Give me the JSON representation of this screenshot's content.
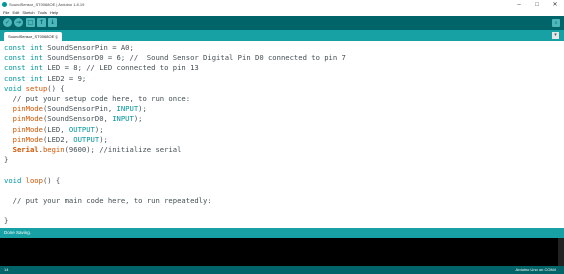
{
  "window": {
    "title": "SoundSensor_ST0068OE | Arduino 1.8.19",
    "minimize_label": "–",
    "maximize_label": "□",
    "close_label": "✕"
  },
  "menu": {
    "items": [
      "File",
      "Edit",
      "Sketch",
      "Tools",
      "Help"
    ]
  },
  "toolbar": {
    "verify_icon": "✓",
    "upload_icon": "→",
    "new_icon": "□",
    "open_icon": "↑",
    "save_icon": "↓",
    "serial_icon": "⌕"
  },
  "tabs": {
    "active_label": "SoundSensor_ST0068OE §",
    "menu_icon": "▾"
  },
  "console": {
    "header": "Done Saving."
  },
  "status": {
    "line": "14",
    "board": "Arduino Uno on COM4"
  },
  "colors": {
    "toolbar": "#006468",
    "tabbar": "#17a1a5",
    "keyword": "#00979c",
    "function": "#d35400"
  }
}
